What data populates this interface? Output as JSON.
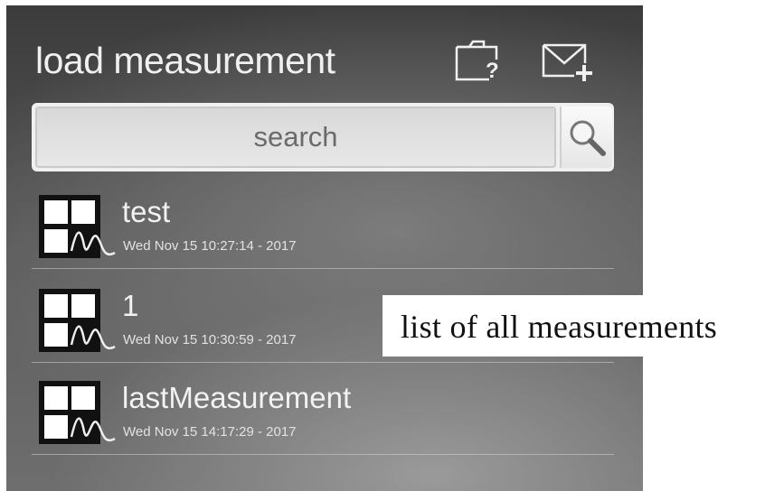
{
  "header": {
    "title": "load measurement",
    "folder_icon": "folder-question-icon",
    "mail_icon": "mail-add-icon"
  },
  "search": {
    "placeholder": "search",
    "button_icon": "search-icon"
  },
  "measurements": [
    {
      "name": "test",
      "date": "Wed Nov 15 10:27:14 - 2017",
      "icon": "measurement-icon"
    },
    {
      "name": "1",
      "date": "Wed Nov 15 10:30:59 - 2017",
      "icon": "measurement-icon"
    },
    {
      "name": "lastMeasurement",
      "date": "Wed Nov 15 14:17:29 - 2017",
      "icon": "measurement-icon"
    }
  ],
  "callout": {
    "text": "list of all measurements"
  }
}
